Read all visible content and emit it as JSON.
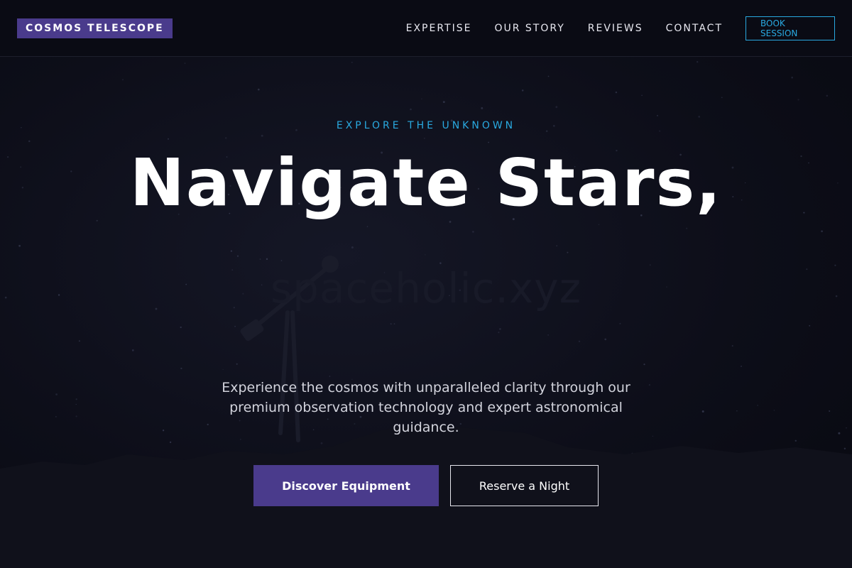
{
  "header": {
    "logo": "COSMOS TELESCOPE",
    "nav": [
      {
        "label": "EXPERTISE"
      },
      {
        "label": "OUR STORY"
      },
      {
        "label": "REVIEWS"
      },
      {
        "label": "CONTACT"
      }
    ],
    "cta_label": "BOOK SESSION"
  },
  "hero": {
    "eyebrow": "EXPLORE THE UNKNOWN",
    "headline": "Navigate Stars,",
    "watermark": "spaceholic.xyz",
    "description": "Experience the cosmos with unparalleled clarity through our premium observation technology and expert astronomical guidance.",
    "primary_button": "Discover Equipment",
    "secondary_button": "Reserve a Night"
  },
  "colors": {
    "brand": "#4a3b8c",
    "accent": "#29a9e0",
    "background": "#0b0c16"
  },
  "icons": [
    "telescope-silhouette"
  ]
}
